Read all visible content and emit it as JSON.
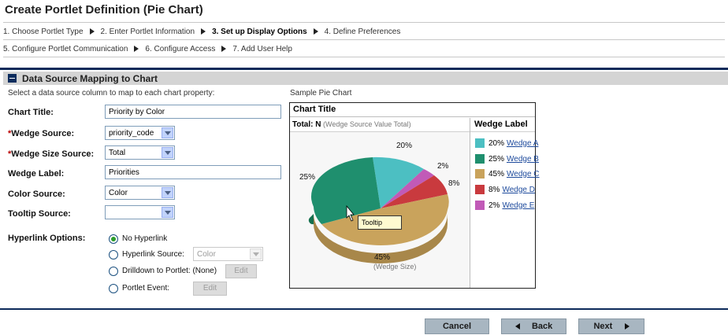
{
  "page_title": "Create Portlet Definition (Pie Chart)",
  "wizard": {
    "row1": [
      {
        "label": "1. Choose Portlet Type",
        "current": false
      },
      {
        "label": "2. Enter Portlet Information",
        "current": false
      },
      {
        "label": "3. Set up Display Options",
        "current": true
      },
      {
        "label": "4. Define Preferences",
        "current": false
      }
    ],
    "row2": [
      {
        "label": "5. Configure Portlet Communication",
        "current": false
      },
      {
        "label": "6. Configure Access",
        "current": false
      },
      {
        "label": "7. Add User Help",
        "current": false
      }
    ]
  },
  "section": {
    "title": "Data Source Mapping to Chart",
    "instructions": "Select a data source column to map to each chart property:",
    "sample_label": "Sample Pie Chart"
  },
  "form": {
    "chart_title": {
      "label": "Chart Title:",
      "value": "Priority by Color"
    },
    "wedge_source": {
      "required": "*",
      "label": "Wedge Source:",
      "value": "priority_code"
    },
    "wedge_size_source": {
      "required": "*",
      "label": "Wedge Size Source:",
      "value": "Total"
    },
    "wedge_label": {
      "label": "Wedge Label:",
      "value": "Priorities"
    },
    "color_source": {
      "label": "Color Source:",
      "value": "Color"
    },
    "tooltip_source": {
      "label": "Tooltip Source:",
      "value": ""
    },
    "hyperlink": {
      "label": "Hyperlink Options:",
      "no_hyperlink": "No Hyperlink",
      "hyperlink_source": "Hyperlink Source:",
      "hyperlink_source_value": "Color",
      "drilldown": "Drilldown to Portlet: (None)",
      "drilldown_edit": "Edit",
      "portlet_event": "Portlet Event:",
      "portlet_event_edit": "Edit"
    }
  },
  "sample_chart": {
    "title": "Chart Title",
    "total_label": "Total: N",
    "total_note": "(Wedge Source Value Total)",
    "legend_header": "Wedge Label",
    "size_note": "(Wedge Size)",
    "tooltip": "Tooltip",
    "wedges": [
      {
        "pct": "20%",
        "name": "Wedge A",
        "color": "#4cbfc2"
      },
      {
        "pct": "25%",
        "name": "Wedge B",
        "color": "#1f8f6e"
      },
      {
        "pct": "45%",
        "name": "Wedge C",
        "color": "#c9a35c"
      },
      {
        "pct": "8%",
        "name": "Wedge D",
        "color": "#c93a3e"
      },
      {
        "pct": "2%",
        "name": "Wedge E",
        "color": "#c15ab7"
      }
    ]
  },
  "buttons": {
    "cancel": "Cancel",
    "back": "Back",
    "next": "Next"
  }
}
